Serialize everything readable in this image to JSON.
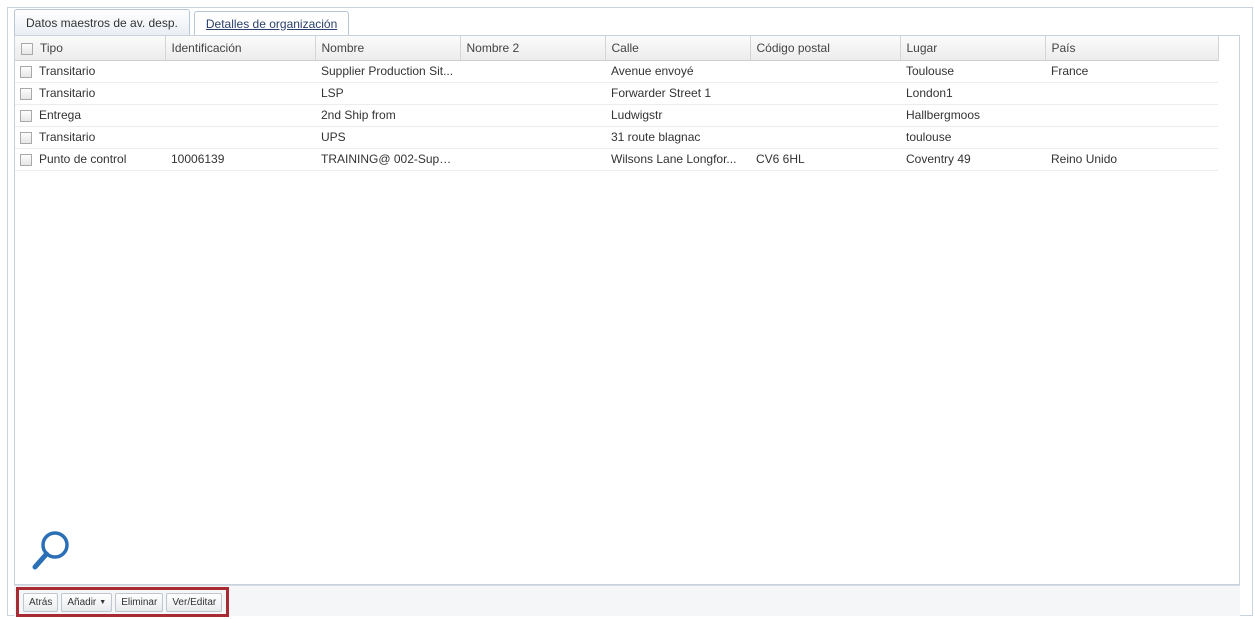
{
  "tabs": [
    {
      "label": "Datos maestros de av. desp."
    },
    {
      "label": "Detalles de organización"
    }
  ],
  "grid": {
    "columns": [
      "Tipo",
      "Identificación",
      "Nombre",
      "Nombre 2",
      "Calle",
      "Código postal",
      "Lugar",
      "País"
    ],
    "rows": [
      [
        "Transitario",
        "",
        "Supplier Production Sit...",
        "",
        "Avenue envoyé",
        "",
        "Toulouse",
        "France"
      ],
      [
        "Transitario",
        "",
        "LSP",
        "",
        "Forwarder Street 1",
        "",
        "London1",
        ""
      ],
      [
        "Entrega",
        "",
        "2nd Ship from",
        "",
        "Ludwigstr",
        "",
        "Hallbergmoos",
        ""
      ],
      [
        "Transitario",
        "",
        "UPS",
        "",
        "31 route blagnac",
        "",
        "toulouse",
        ""
      ],
      [
        "Punto de control",
        "10006139",
        "TRAINING@ 002-SupA...",
        "",
        "Wilsons Lane Longfor...",
        "CV6 6HL",
        "Coventry 49",
        "Reino Unido"
      ]
    ]
  },
  "toolbar": {
    "back_label": "Atrás",
    "add_label": "Añadir",
    "delete_label": "Eliminar",
    "view_edit_label": "Ver/Editar"
  },
  "icons": {
    "search": "search-icon",
    "dropdown": "caret-down-icon"
  },
  "colors": {
    "highlight_border": "#a82a33",
    "search_icon": "#2b6fb6"
  }
}
